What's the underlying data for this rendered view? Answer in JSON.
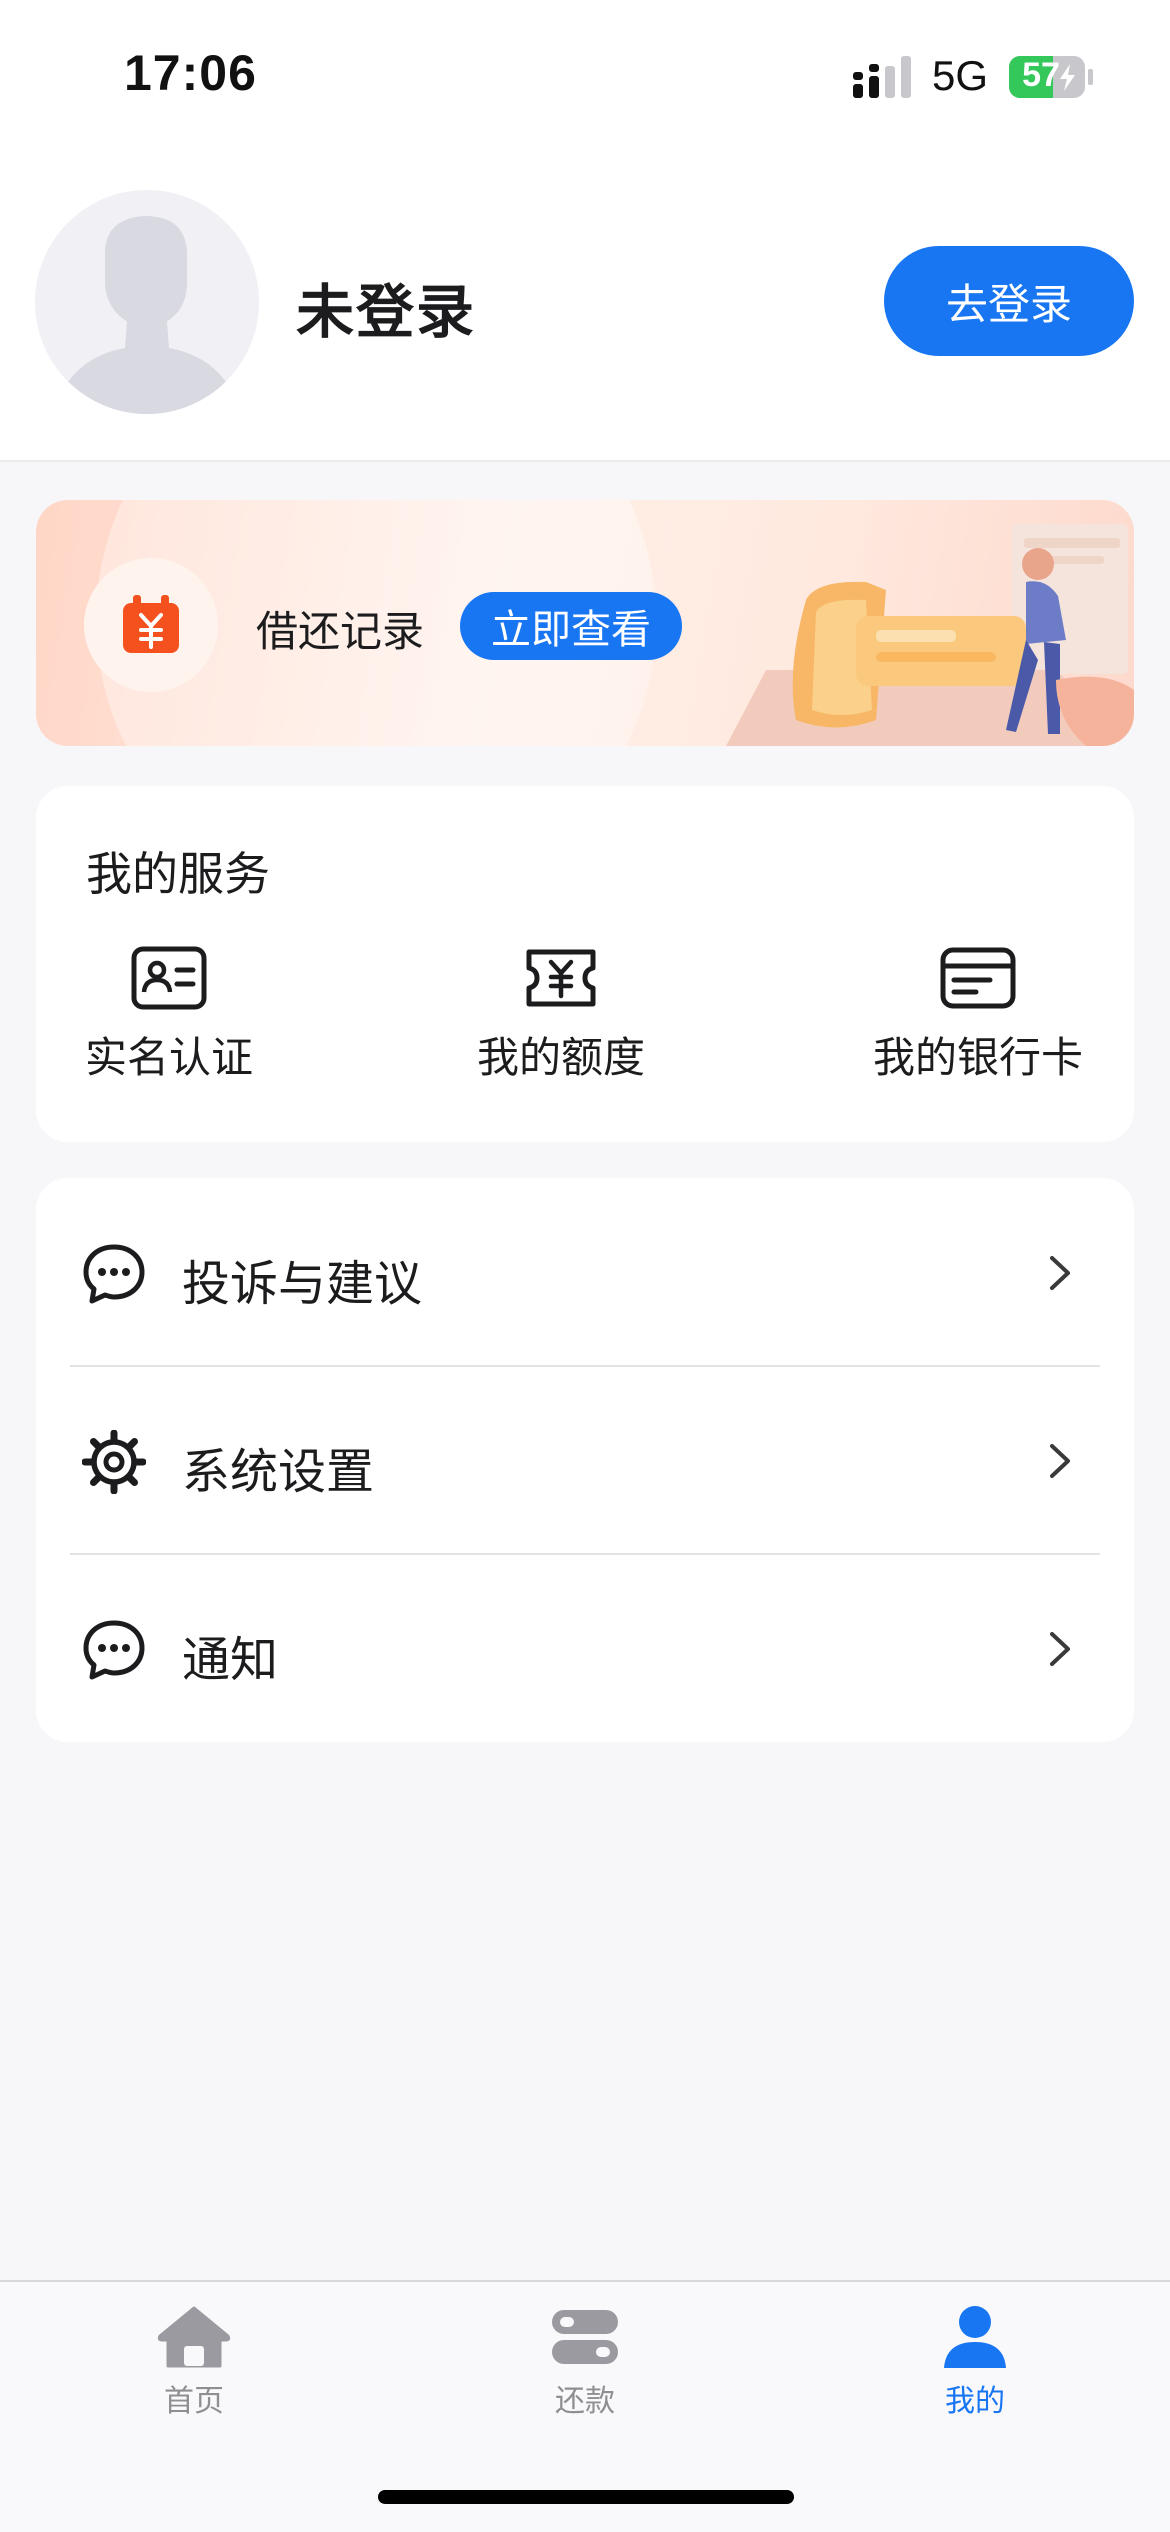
{
  "status_bar": {
    "time": "17:06",
    "network": "5G",
    "battery": "57"
  },
  "profile": {
    "name": "未登录",
    "login_button": "去登录"
  },
  "banner": {
    "title": "借还记录",
    "cta": "立即查看",
    "icon": "calendar-yuan-icon"
  },
  "services": {
    "title": "我的服务",
    "items": [
      {
        "label": "实名认证",
        "icon": "id-card-icon"
      },
      {
        "label": "我的额度",
        "icon": "yuan-ticket-icon"
      },
      {
        "label": "我的银行卡",
        "icon": "bank-card-icon"
      }
    ]
  },
  "menu": {
    "items": [
      {
        "label": "投诉与建议",
        "icon": "chat-bubble-icon"
      },
      {
        "label": "系统设置",
        "icon": "gear-icon"
      },
      {
        "label": "通知",
        "icon": "chat-bubble-icon"
      }
    ]
  },
  "tabbar": {
    "items": [
      {
        "label": "首页",
        "icon": "home-icon",
        "active": false
      },
      {
        "label": "还款",
        "icon": "repay-icon",
        "active": false
      },
      {
        "label": "我的",
        "icon": "user-icon",
        "active": true
      }
    ]
  },
  "colors": {
    "accent": "#1876f2",
    "banner_icon": "#f4511e"
  }
}
